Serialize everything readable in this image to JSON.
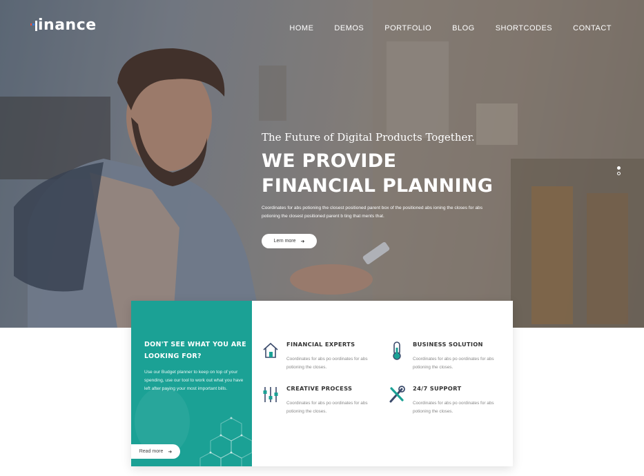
{
  "brand": {
    "logo_text": "inance"
  },
  "nav": {
    "items": [
      "HOME",
      "DEMOS",
      "PORTFOLIO",
      "BLOG",
      "SHORTCODES",
      "CONTACT"
    ]
  },
  "hero": {
    "tagline": "The Future of Digital Products Together.",
    "headline_line1": "WE PROVIDE",
    "headline_line2": "FINANCIAL PLANNING",
    "description": "Coordinates for abs potioning the closest positioned parent box of the positioned abs ioning the closes for abs potioning the closest positioned parent b ting that ments that.",
    "button_label": "Lern more",
    "slider_dots": 2
  },
  "promo": {
    "title": "DON'T SEE WHAT YOU ARE LOOKING FOR?",
    "text": "Use our Budget planner to keep on top of your spending, use our tool to work out what you have left after paying your most important bills.",
    "button_label": "Read more"
  },
  "services": [
    {
      "icon": "house-icon",
      "title": "FINANCIAL EXPERTS",
      "text": "Coordinates for abs po oordinates for abs potioning the closes."
    },
    {
      "icon": "thermometer-icon",
      "title": "BUSINESS SOLUTION",
      "text": "Coordinates for abs po oordinates for abs potioning the closes."
    },
    {
      "icon": "sliders-icon",
      "title": "CREATIVE PROCESS",
      "text": "Coordinates for abs po oordinates for abs potioning the closes."
    },
    {
      "icon": "tools-icon",
      "title": "24/7 SUPPORT",
      "text": "Coordinates for abs po oordinates for abs potioning the closes."
    }
  ],
  "colors": {
    "accent": "#1ba195",
    "icon_dark": "#3a4a6b",
    "logo_red": "#e94c3d",
    "logo_blue": "#3b7bd8"
  }
}
